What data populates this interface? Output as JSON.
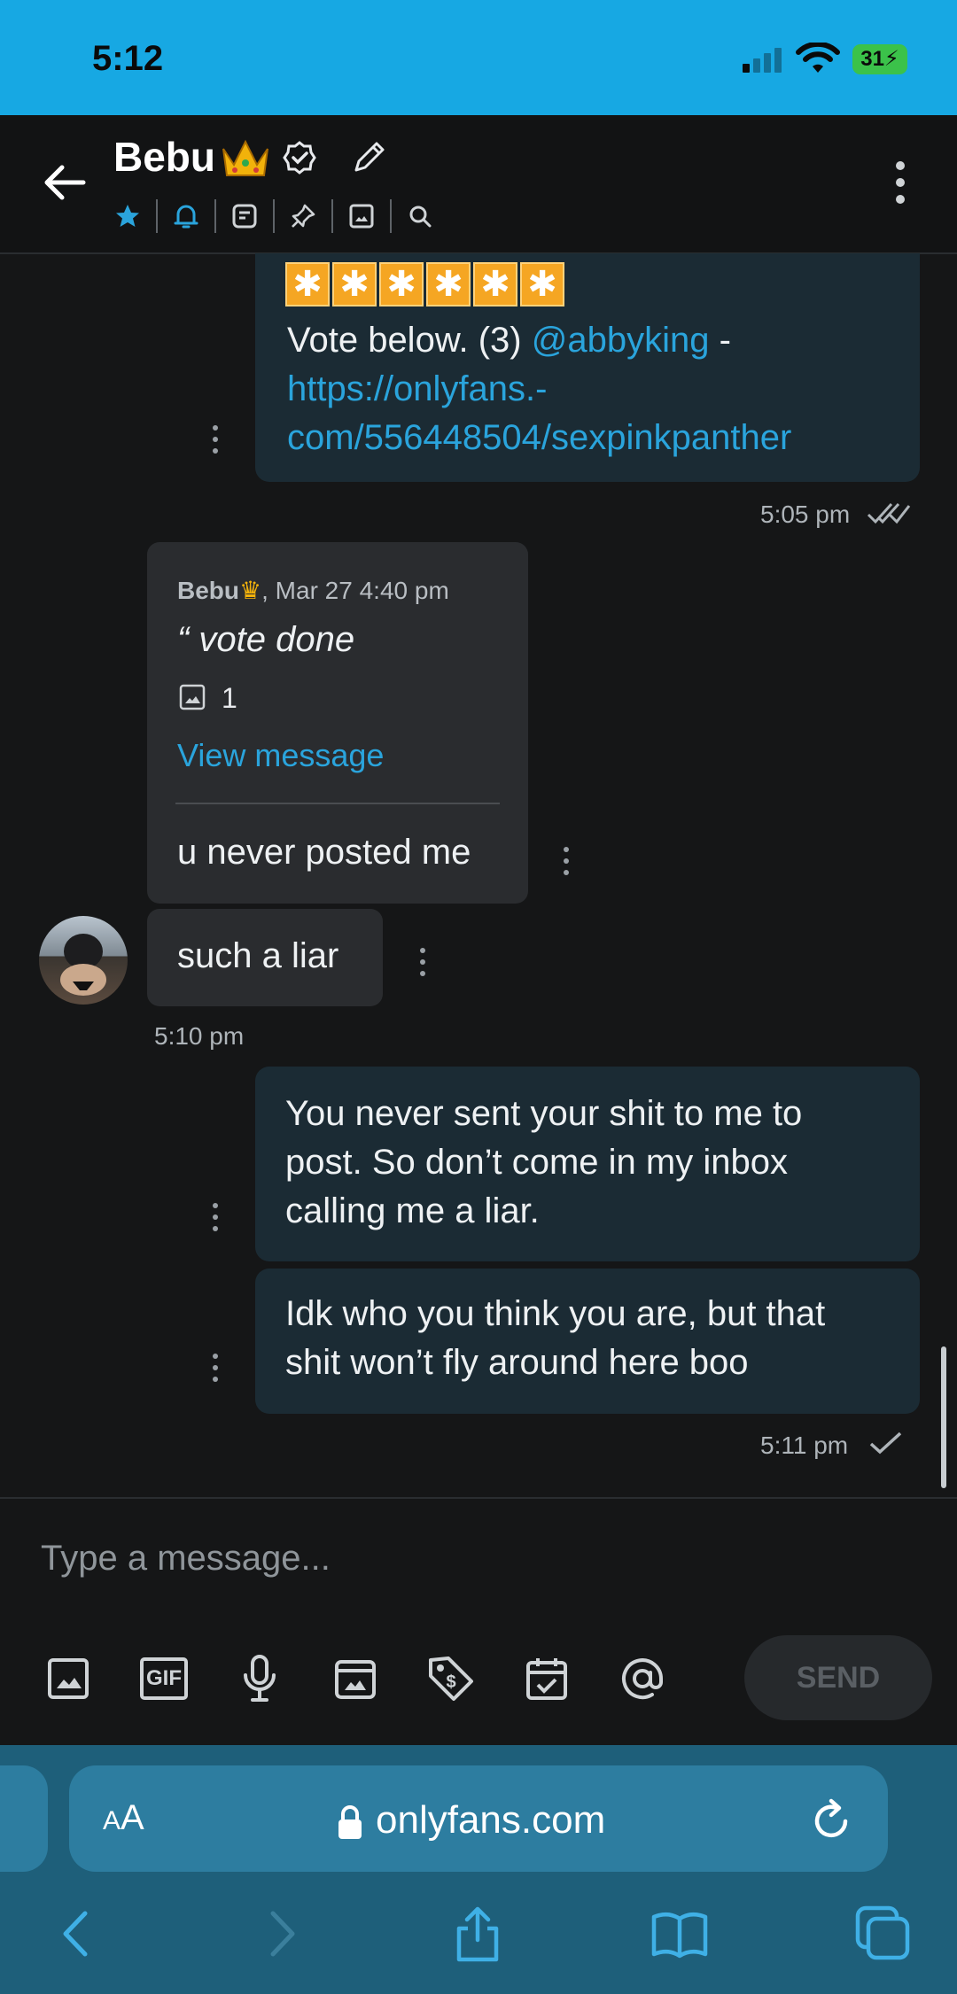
{
  "status_bar": {
    "time": "5:12",
    "battery": "31"
  },
  "header": {
    "title": "Bebu"
  },
  "messages": {
    "m1": {
      "line1": "Vote below. (3) ",
      "mention": "@abbyking",
      "line1_tail": " -",
      "link1": "https://onlyfans.-",
      "link2": "com/556448504/sexpinkpanther",
      "time": "5:05 pm"
    },
    "quote": {
      "sender": "Bebu",
      "date": ", Mar 27 4:40 pm",
      "text": "“ vote done",
      "media_count": "1",
      "view_label": "View message"
    },
    "m2": {
      "text": "u never posted me"
    },
    "m3": {
      "text": "such a liar",
      "time": "5:10 pm"
    },
    "m4": {
      "line1": "You never sent your shit to me to",
      "line2": "post. So don’t come in my inbox",
      "line3": "calling me a liar."
    },
    "m5": {
      "line1": "Idk who you think you are, but that",
      "line2": "shit won’t fly around here boo",
      "time": "5:11 pm"
    }
  },
  "compose": {
    "placeholder": "Type a message...",
    "send_label": "SEND",
    "gif_label": "GIF"
  },
  "browser": {
    "aa_small": "A",
    "aa_big": "A",
    "url": "onlyfans.com"
  },
  "colors": {
    "accent": "#2aa4dc",
    "status_bar": "#17a8e3",
    "outgoing_bubble": "#1b2b34",
    "incoming_bubble": "#2a2c2f",
    "battery": "#3bc24a"
  }
}
